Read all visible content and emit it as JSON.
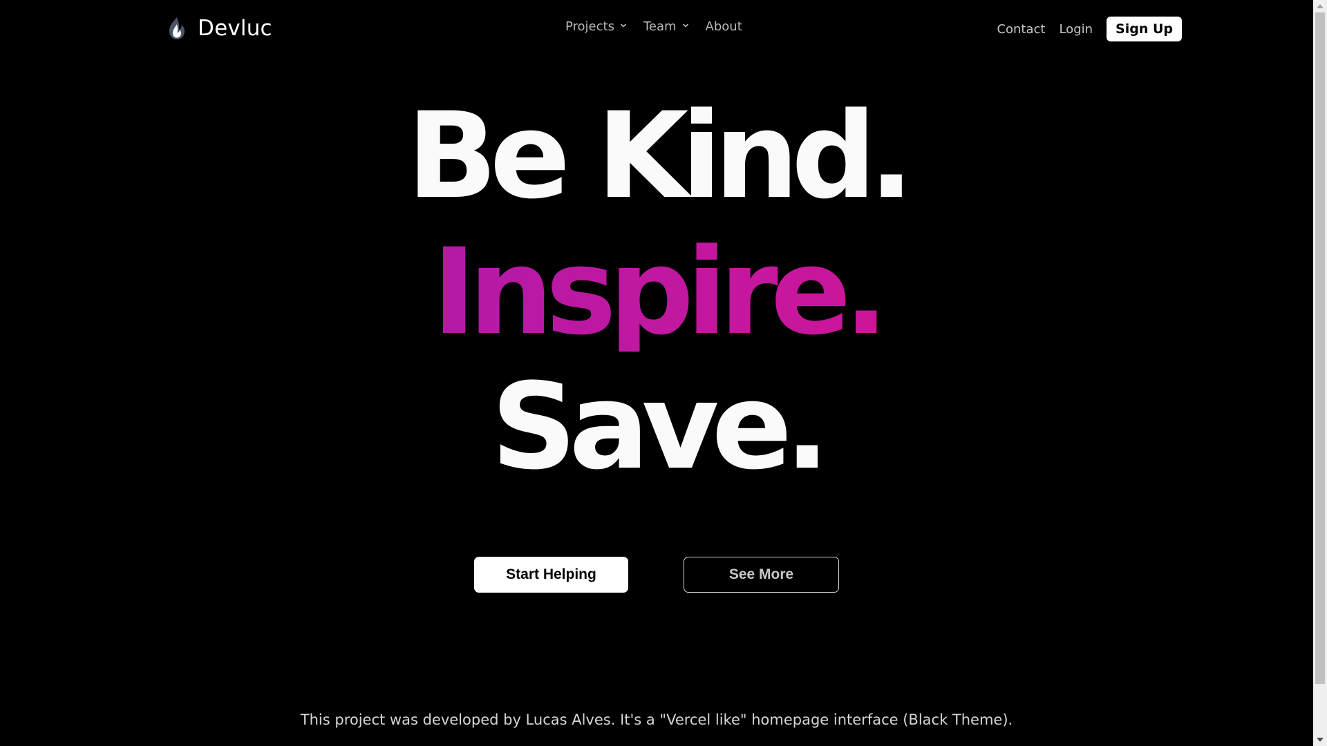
{
  "navbar": {
    "brand": "Devluc",
    "links": [
      {
        "label": "Projects",
        "dropdown": true
      },
      {
        "label": "Team",
        "dropdown": true
      },
      {
        "label": "About",
        "dropdown": false
      }
    ],
    "contact": "Contact",
    "login": "Login",
    "signup": "Sign Up"
  },
  "hero": {
    "line1": "Be Kind.",
    "line2": "Inspire.",
    "line3": "Save.",
    "accent_gradient": [
      "#9a1fb0",
      "#c4179f",
      "#e0148b"
    ]
  },
  "cta": {
    "primary": "Start Helping",
    "secondary": "See More"
  },
  "footer": {
    "text": "This project was developed by Lucas Alves. It's a \"Vercel like\" homepage interface (Black Theme)."
  },
  "icons": {
    "brand_logo": "flame-icon",
    "dropdown": "chevron-down-icon"
  },
  "colors": {
    "background": "#000000",
    "text": "#ffffff",
    "muted": "#b9b9b9"
  }
}
